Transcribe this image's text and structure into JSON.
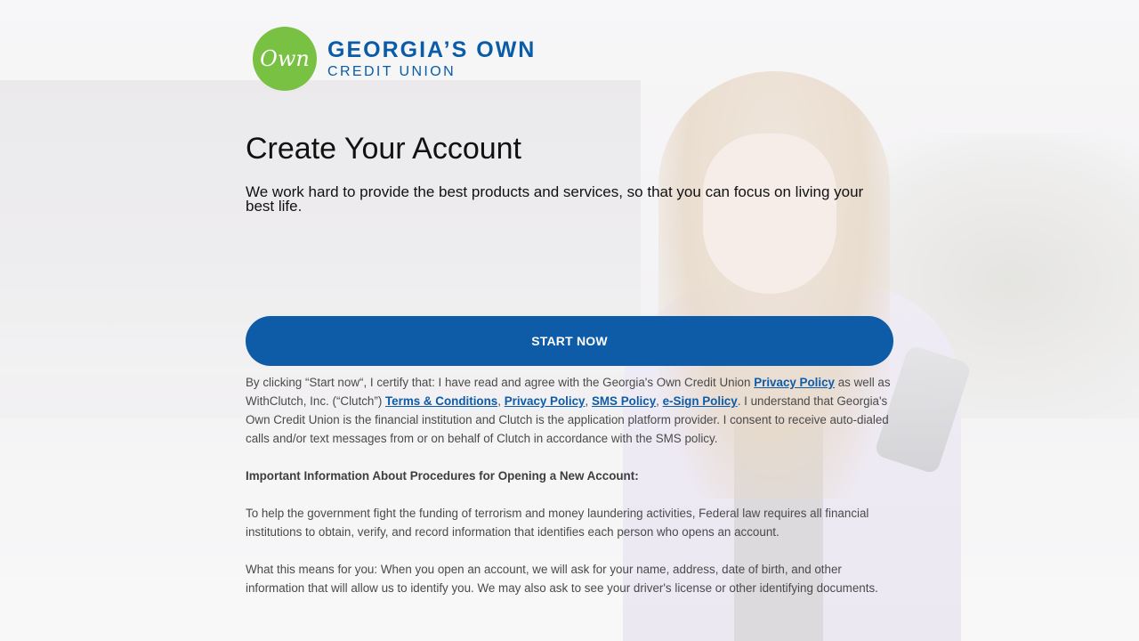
{
  "brand": {
    "logo_mark": "Own",
    "name_line1": "GEORGIA’S OWN",
    "name_line2": "CREDIT UNION",
    "logo_color": "#78c142",
    "brand_color": "#0a5ca8"
  },
  "page": {
    "title": "Create Your Account",
    "subtitle": "We work hard to provide the best products and services, so that you can focus on living your best life."
  },
  "cta": {
    "start_label": "START NOW",
    "color": "#0e5ba8"
  },
  "consent": {
    "t1": "By clicking “Start now“, I certify that: I have read and agree with the Georgia's Own Credit Union ",
    "link_privacy_cu": "Privacy Policy",
    "t2": " as well as WithClutch, Inc. (“Clutch”) ",
    "link_terms": "Terms & Conditions",
    "sep1": ", ",
    "link_privacy_clutch": "Privacy Policy",
    "sep2": ", ",
    "link_sms": "SMS Policy",
    "sep3": ", ",
    "link_esign": "e-Sign Policy",
    "t3": ". I understand that Georgia's Own Credit Union is the financial institution and Clutch is the application platform provider. I consent to receive auto-dialed calls and/or text messages from or on behalf of Clutch in accordance with the SMS policy."
  },
  "important": {
    "heading": "Important Information About Procedures for Opening a New Account:",
    "p1": "To help the government fight the funding of terrorism and money laundering activities, Federal law requires all financial institutions to obtain, verify, and record information that identifies each person who opens an account.",
    "p2": "What this means for you: When you open an account, we will ask for your name, address, date of birth, and other information that will allow us to identify you. We may also ask to see your driver's license or other identifying documents."
  }
}
